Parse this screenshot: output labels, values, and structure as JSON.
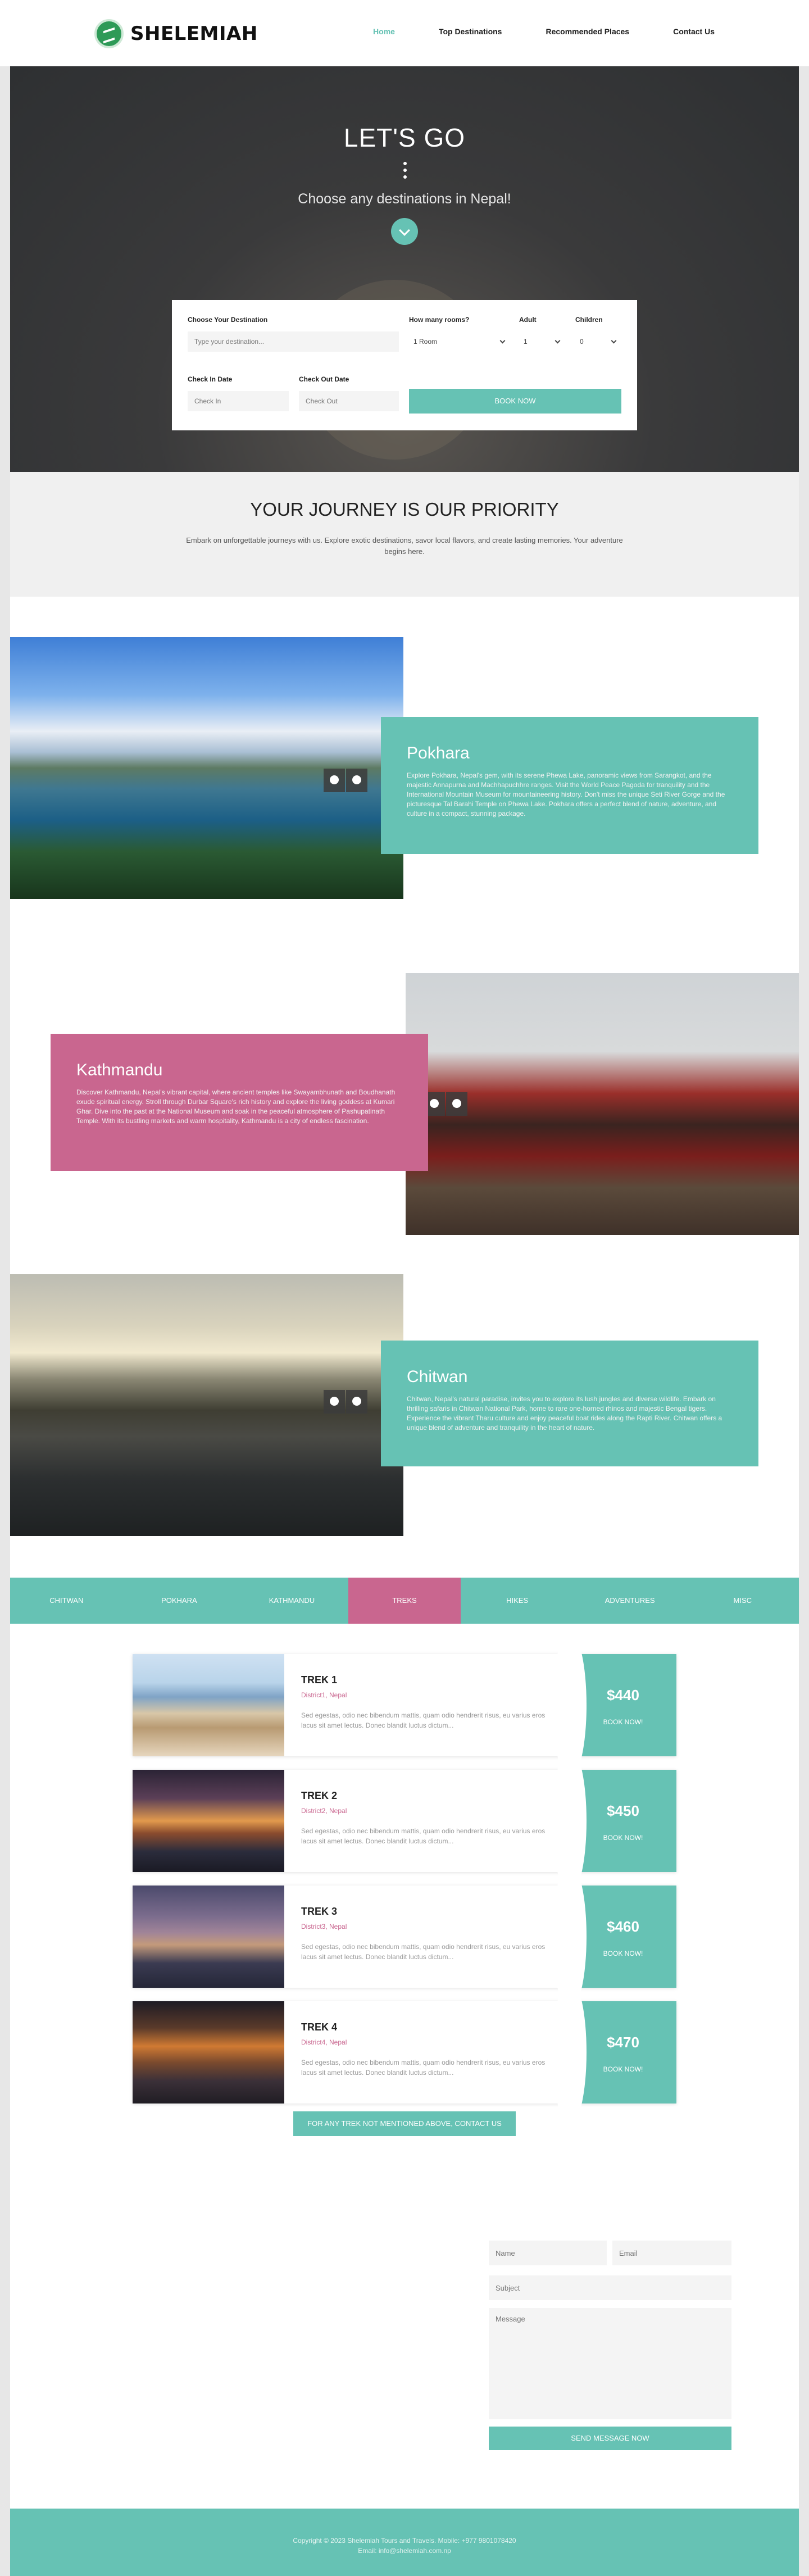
{
  "brand": {
    "name": "SHELEMIAH"
  },
  "nav": [
    {
      "label": "Home",
      "active": true
    },
    {
      "label": "Top Destinations",
      "active": false
    },
    {
      "label": "Recommended Places",
      "active": false
    },
    {
      "label": "Contact Us",
      "active": false
    }
  ],
  "hero": {
    "title": "LET'S GO",
    "subtitle": "Choose any destinations in Nepal!",
    "scroll_icon": "chevron-down-icon"
  },
  "booking": {
    "destination_label": "Choose Your Destination",
    "destination_placeholder": "Type your destination...",
    "rooms_label": "How many rooms?",
    "rooms_value": "1 Room",
    "adult_label": "Adult",
    "adult_value": "1",
    "children_label": "Children",
    "children_value": "0",
    "checkin_label": "Check In Date",
    "checkin_placeholder": "Check In",
    "checkout_label": "Check Out Date",
    "checkout_placeholder": "Check Out",
    "book_button": "BOOK NOW"
  },
  "priority": {
    "title": "YOUR JOURNEY IS OUR PRIORITY",
    "text": "Embark on unforgettable journeys with us. Explore exotic destinations, savor local flavors, and create lasting memories. Your adventure begins here."
  },
  "destinations": [
    {
      "name": "Pokhara",
      "text": "Explore Pokhara, Nepal's gem, with its serene Phewa Lake, panoramic views from Sarangkot, and the majestic Annapurna and Machhapuchhre ranges. Visit the World Peace Pagoda for tranquility and the International Mountain Museum for mountaineering history. Don't miss the unique Seti River Gorge and the picturesque Tal Barahi Temple on Phewa Lake. Pokhara offers a perfect blend of nature, adventure, and culture in a compact, stunning package."
    },
    {
      "name": "Kathmandu",
      "text": "Discover Kathmandu, Nepal's vibrant capital, where ancient temples like Swayambhunath and Boudhanath exude spiritual energy. Stroll through Durbar Square's rich history and explore the living goddess at Kumari Ghar. Dive into the past at the National Museum and soak in the peaceful atmosphere of Pashupatinath Temple. With its bustling markets and warm hospitality, Kathmandu is a city of endless fascination."
    },
    {
      "name": "Chitwan",
      "text": "Chitwan, Nepal's natural paradise, invites you to explore its lush jungles and diverse wildlife. Embark on thrilling safaris in Chitwan National Park, home to rare one-horned rhinos and majestic Bengal tigers. Experience the vibrant Tharu culture and enjoy peaceful boat rides along the Rapti River. Chitwan offers a unique blend of adventure and tranquility in the heart of nature."
    }
  ],
  "tabs": [
    {
      "label": "CHITWAN",
      "active": false
    },
    {
      "label": "POKHARA",
      "active": false
    },
    {
      "label": "KATHMANDU",
      "active": false
    },
    {
      "label": "TREKS",
      "active": true
    },
    {
      "label": "HIKES",
      "active": false
    },
    {
      "label": "ADVENTURES",
      "active": false
    },
    {
      "label": "MISC",
      "active": false
    }
  ],
  "treks": [
    {
      "title": "TREK 1",
      "location": "District1, Nepal",
      "desc": "Sed egestas, odio nec bibendum mattis, quam odio hendrerit risus, eu varius eros lacus sit amet lectus. Donec blandit luctus dictum...",
      "price": "$440",
      "button": "BOOK NOW!"
    },
    {
      "title": "TREK 2",
      "location": "District2, Nepal",
      "desc": "Sed egestas, odio nec bibendum mattis, quam odio hendrerit risus, eu varius eros lacus sit amet lectus. Donec blandit luctus dictum...",
      "price": "$450",
      "button": "BOOK NOW!"
    },
    {
      "title": "TREK 3",
      "location": "District3, Nepal",
      "desc": "Sed egestas, odio nec bibendum mattis, quam odio hendrerit risus, eu varius eros lacus sit amet lectus. Donec blandit luctus dictum...",
      "price": "$460",
      "button": "BOOK NOW!"
    },
    {
      "title": "TREK 4",
      "location": "District4, Nepal",
      "desc": "Sed egestas, odio nec bibendum mattis, quam odio hendrerit risus, eu varius eros lacus sit amet lectus. Donec blandit luctus dictum...",
      "price": "$470",
      "button": "BOOK NOW!"
    }
  ],
  "trek_cta": "FOR ANY TREK NOT MENTIONED ABOVE, CONTACT US",
  "contact": {
    "name_placeholder": "Name",
    "email_placeholder": "Email",
    "subject_placeholder": "Subject",
    "message_placeholder": "Message",
    "send_button": "SEND MESSAGE NOW"
  },
  "footer": {
    "copyright": "Copyright © 2023 Shelemiah Tours and Travels. Mobile: +977 9801078420",
    "email": "Email: info@shelemiah.com.np"
  },
  "colors": {
    "accent": "#66c2b4",
    "highlight": "#c9668f"
  }
}
